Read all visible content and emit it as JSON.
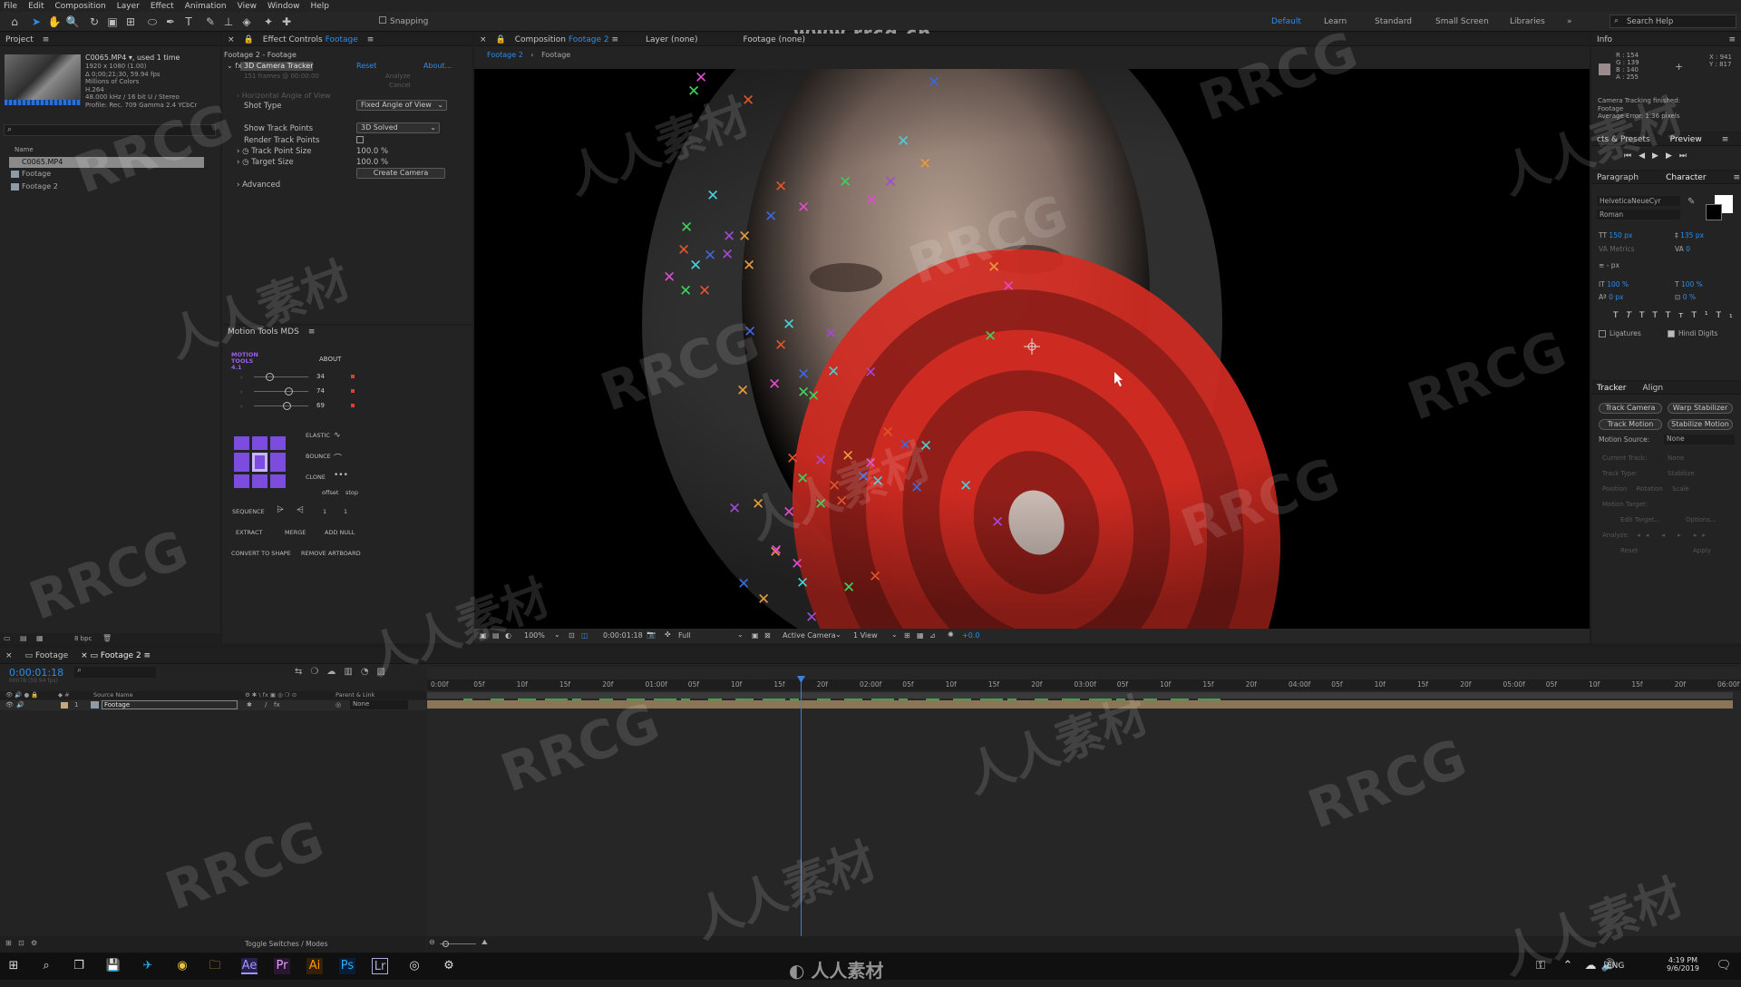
{
  "menu": [
    "File",
    "Edit",
    "Composition",
    "Layer",
    "Effect",
    "Animation",
    "View",
    "Window",
    "Help"
  ],
  "toolbar": {
    "snapping": "Snapping",
    "workspaces": [
      "Default",
      "Learn",
      "Standard",
      "Small Screen",
      "Libraries"
    ],
    "search": "Search Help"
  },
  "watermark_url": "www.rrcg.cn",
  "project": {
    "title": "Project",
    "file": "C0065.MP4 ▾, used 1 time",
    "meta": [
      "1920 x 1080 (1.00)",
      "Δ 0;00;21;30, 59.94 fps",
      "Millions of Colors",
      "H.264",
      "48.000 kHz / 16 bit U / Stereo",
      "Profile: Rec. 709 Gamma 2.4 YCbCr"
    ],
    "col": "Name",
    "items": [
      "C0065.MP4",
      "Footage",
      "Footage 2"
    ],
    "bpc": "8 bpc"
  },
  "effects": {
    "tab": "Effect Controls",
    "tab_target": "Footage",
    "header": "Footage 2 - Footage",
    "effect": "3D Camera Tracker",
    "reset": "Reset",
    "about": "About...",
    "frames": "151 frames @ 00:00:00",
    "analyze": "Analyze",
    "cancel": "Cancel",
    "props": [
      {
        "label": "Horizontal Angle of View",
        "value": ""
      },
      {
        "label": "Shot Type",
        "value": "Fixed Angle of View"
      },
      {
        "label": "Show Track Points",
        "value": "3D Solved"
      },
      {
        "label": "Render Track Points",
        "value": ""
      },
      {
        "label": "Track Point Size",
        "value": "100.0 %"
      },
      {
        "label": "Target Size",
        "value": "100.0 %"
      }
    ],
    "create": "Create Camera",
    "advanced": "Advanced"
  },
  "motiontools": {
    "title": "Motion Tools MDS",
    "logo": "MOTION TOOLS 4.1",
    "about": "ABOUT",
    "vals": [
      "34",
      "74",
      "69"
    ],
    "labels": [
      "ELASTIC",
      "BOUNCE",
      "CLONE",
      "offset",
      "stop",
      "SEQUENCE",
      "EXTRACT",
      "MERGE",
      "ADD NULL",
      "CONVERT TO SHAPE",
      "REMOVE ARTBOARD"
    ],
    "seq": [
      "1",
      "1"
    ]
  },
  "comp": {
    "tab": "Composition",
    "tab_target": "Footage 2",
    "layer": "Layer (none)",
    "footage": "Footage (none)",
    "sub": [
      "Footage 2",
      "Footage"
    ],
    "zoom": "100%",
    "time": "0:00:01:18",
    "res": "Full",
    "camera": "Active Camera",
    "views": "1 View",
    "exposure": "+0.0"
  },
  "info": {
    "title": "Info",
    "rgba": [
      "R : 154",
      "G : 139",
      "B : 140",
      "A : 255"
    ],
    "xy": [
      "X : 941",
      "Y : 817"
    ],
    "msg": [
      "Camera Tracking finished:",
      "Footage",
      "Average Error: 1.36 pixels"
    ]
  },
  "preview": {
    "tabs": [
      "cts & Presets",
      "Preview"
    ]
  },
  "character": {
    "tabs": [
      "Paragraph",
      "Character"
    ],
    "font": "HelveticaNeueCyr",
    "style": "Roman",
    "size": "150 px",
    "leading": "135 px",
    "kern": "Metrics",
    "track": "0",
    "stroke": "- px",
    "vscale": "100 %",
    "hscale": "100 %",
    "baseline": "0 px",
    "tsume": "0 %",
    "ligatures": "Ligatures",
    "hindi": "Hindi Digits"
  },
  "tracker": {
    "tabs": [
      "Tracker",
      "Align"
    ],
    "buttons": [
      "Track Camera",
      "Warp Stabilizer",
      "Track Motion",
      "Stabilize Motion"
    ],
    "motion_source": "Motion Source:",
    "source_val": "None",
    "dim": [
      "Current Track:",
      "None",
      "Track Type:",
      "Stabilize",
      "Position",
      "Rotation",
      "Scale",
      "Motion Target:",
      "Edit Target...",
      "Options...",
      "Analyze:",
      "Reset",
      "Apply"
    ]
  },
  "timeline": {
    "tabs": [
      "Footage",
      "Footage 2"
    ],
    "time": "0:00:01:18",
    "fps": "00078 (59.94 fps)",
    "cols": [
      "Source Name",
      "Parent & Link"
    ],
    "layer_num": "1",
    "layer_name": "Footage",
    "parent": "None",
    "toggle": "Toggle Switches / Modes",
    "ticks": [
      "0:00f",
      "05f",
      "10f",
      "15f",
      "20f",
      "01:00f",
      "05f",
      "10f",
      "15f",
      "20f",
      "02:00f",
      "05f",
      "10f",
      "15f",
      "20f",
      "03:00f",
      "05f",
      "10f",
      "15f",
      "20f",
      "04:00f",
      "05f",
      "10f",
      "15f",
      "20f",
      "05:00f",
      "05f",
      "10f",
      "15f",
      "20f",
      "06:00f"
    ]
  },
  "taskbar": {
    "lang": "ENG",
    "time": "4:19 PM",
    "date": "9/6/2019"
  },
  "colors": {
    "accent": "#2d8ceb",
    "panel": "#232323",
    "target": "#e0342a"
  }
}
